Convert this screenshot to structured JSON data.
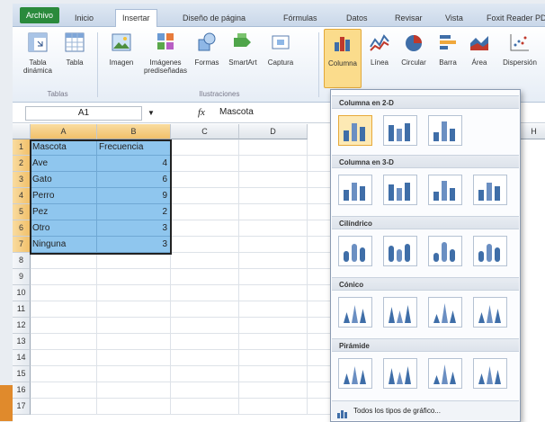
{
  "tabs": [
    "Archivo",
    "Inicio",
    "Insertar",
    "Diseño de página",
    "Fórmulas",
    "Datos",
    "Revisar",
    "Vista",
    "Foxit Reader PDF"
  ],
  "ribbon": {
    "tabla_dinamica": "Tabla dinámica",
    "tabla": "Tabla",
    "imagen": "Imagen",
    "imagenes_prediseñadas": "Imágenes prediseñadas",
    "formas": "Formas",
    "smartart": "SmartArt",
    "captura": "Captura",
    "columna": "Columna",
    "linea": "Línea",
    "circular": "Circular",
    "barra": "Barra",
    "area": "Área",
    "dispersion": "Dispersión",
    "group_tablas": "Tablas",
    "group_ilustraciones": "Ilustraciones"
  },
  "formula_bar": {
    "name_box": "A1",
    "fx": "fx",
    "value": "Mascota"
  },
  "columns": [
    "A",
    "B",
    "C",
    "D",
    "H"
  ],
  "rows": [
    "1",
    "2",
    "3",
    "4",
    "5",
    "6",
    "7",
    "8",
    "9",
    "10",
    "11",
    "12",
    "13",
    "14",
    "15",
    "16",
    "17"
  ],
  "table": {
    "headers": [
      "Mascota",
      "Frecuencia"
    ],
    "rows": [
      [
        "Ave",
        "4"
      ],
      [
        "Gato",
        "6"
      ],
      [
        "Perro",
        "9"
      ],
      [
        "Pez",
        "2"
      ],
      [
        "Otro",
        "3"
      ],
      [
        "Ninguna",
        "3"
      ]
    ]
  },
  "dropdown": {
    "sections": [
      "Columna en 2-D",
      "Columna en 3-D",
      "Cilíndrico",
      "Cónico",
      "Pirámide"
    ],
    "footer": "Todos los tipos de gráfico..."
  },
  "colors": {
    "selection": "#8fc6ee",
    "file_tab": "#2a8a3c",
    "highlight": "#fde9b4"
  }
}
